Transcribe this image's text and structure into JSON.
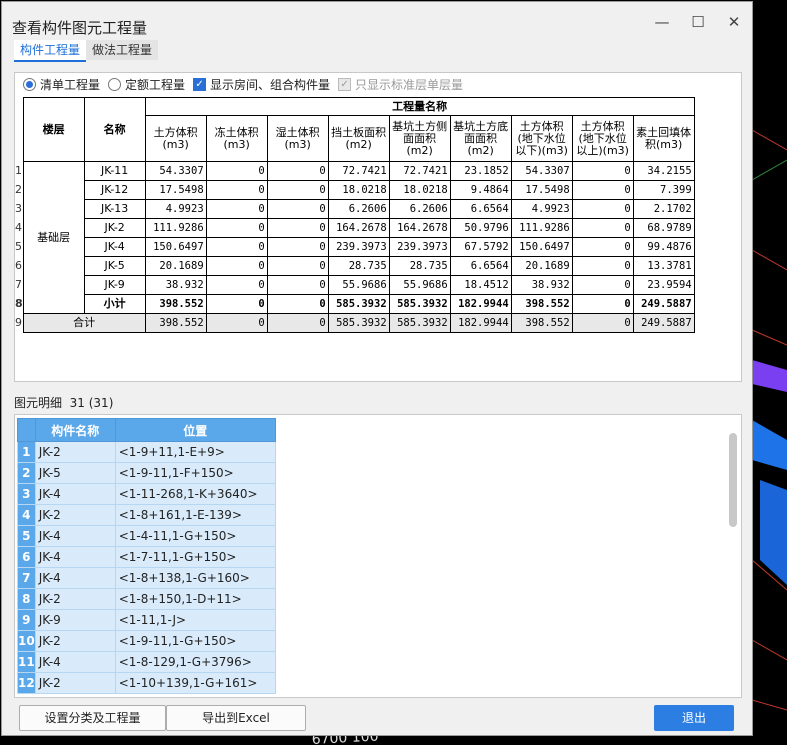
{
  "window": {
    "title": "查看构件图元工程量",
    "minimize": "—",
    "maximize": "☐",
    "close": "✕"
  },
  "tabs": [
    {
      "label": "构件工程量"
    },
    {
      "label": "做法工程量"
    }
  ],
  "options": {
    "radio_bill": "清单工程量",
    "radio_quota": "定额工程量",
    "check_rooms": "显示房间、组合构件量",
    "check_std": "只显示标准层单层量"
  },
  "table": {
    "group_header": "工程量名称",
    "col_floor": "楼层",
    "col_name": "名称",
    "columns": [
      "土方体积(m3)",
      "冻土体积(m3)",
      "湿土体积(m3)",
      "挡土板面积(m2)",
      "基坑土方侧面面积(m2)",
      "基坑土方底面面积(m2)",
      "土方体积(地下水位以下)(m3)",
      "土方体积(地下水位以上)(m3)",
      "素土回填体积(m3)"
    ],
    "floor": "基础层",
    "row_numbers": [
      "1",
      "2",
      "3",
      "4",
      "5",
      "6",
      "7",
      "8",
      "9"
    ],
    "rows": [
      {
        "name": "JK-11",
        "values": [
          "54.3307",
          "0",
          "0",
          "72.7421",
          "72.7421",
          "23.1852",
          "54.3307",
          "0",
          "34.2155"
        ]
      },
      {
        "name": "JK-12",
        "values": [
          "17.5498",
          "0",
          "0",
          "18.0218",
          "18.0218",
          "9.4864",
          "17.5498",
          "0",
          "7.399"
        ]
      },
      {
        "name": "JK-13",
        "values": [
          "4.9923",
          "0",
          "0",
          "6.2606",
          "6.2606",
          "6.6564",
          "4.9923",
          "0",
          "2.1702"
        ]
      },
      {
        "name": "JK-2",
        "values": [
          "111.9286",
          "0",
          "0",
          "164.2678",
          "164.2678",
          "50.9796",
          "111.9286",
          "0",
          "68.9789"
        ]
      },
      {
        "name": "JK-4",
        "values": [
          "150.6497",
          "0",
          "0",
          "239.3973",
          "239.3973",
          "67.5792",
          "150.6497",
          "0",
          "99.4876"
        ]
      },
      {
        "name": "JK-5",
        "values": [
          "20.1689",
          "0",
          "0",
          "28.735",
          "28.735",
          "6.6564",
          "20.1689",
          "0",
          "13.3781"
        ]
      },
      {
        "name": "JK-9",
        "values": [
          "38.932",
          "0",
          "0",
          "55.9686",
          "55.9686",
          "18.4512",
          "38.932",
          "0",
          "23.9594"
        ]
      }
    ],
    "subtotal": {
      "name": "小计",
      "values": [
        "398.552",
        "0",
        "0",
        "585.3932",
        "585.3932",
        "182.9944",
        "398.552",
        "0",
        "249.5887"
      ]
    },
    "total": {
      "name": "合计",
      "values": [
        "398.552",
        "0",
        "0",
        "585.3932",
        "585.3932",
        "182.9944",
        "398.552",
        "0",
        "249.5887"
      ]
    }
  },
  "detail": {
    "label": "图元明细",
    "count": "31 (31)",
    "col_name": "构件名称",
    "col_pos": "位置",
    "rows": [
      {
        "idx": "1",
        "name": "JK-2",
        "pos": "<1-9+11,1-E+9>"
      },
      {
        "idx": "2",
        "name": "JK-5",
        "pos": "<1-9-11,1-F+150>"
      },
      {
        "idx": "3",
        "name": "JK-4",
        "pos": "<1-11-268,1-K+3640>"
      },
      {
        "idx": "4",
        "name": "JK-2",
        "pos": "<1-8+161,1-E-139>"
      },
      {
        "idx": "5",
        "name": "JK-4",
        "pos": "<1-4-11,1-G+150>"
      },
      {
        "idx": "6",
        "name": "JK-4",
        "pos": "<1-7-11,1-G+150>"
      },
      {
        "idx": "7",
        "name": "JK-4",
        "pos": "<1-8+138,1-G+160>"
      },
      {
        "idx": "8",
        "name": "JK-2",
        "pos": "<1-8+150,1-D+11>"
      },
      {
        "idx": "9",
        "name": "JK-9",
        "pos": "<1-11,1-J>"
      },
      {
        "idx": "10",
        "name": "JK-2",
        "pos": "<1-9-11,1-G+150>"
      },
      {
        "idx": "11",
        "name": "JK-4",
        "pos": "<1-8-129,1-G+3796>"
      },
      {
        "idx": "12",
        "name": "JK-2",
        "pos": "<1-10+139,1-G+161>"
      }
    ]
  },
  "buttons": {
    "settings": "设置分类及工程量",
    "export": "导出到Excel",
    "exit": "退出"
  },
  "background": {
    "dimension_text": "6700 100"
  },
  "colors": {
    "accent": "#2d7ee3",
    "header_blue": "#5aa7ea",
    "row_blue": "#d9ebfb",
    "bg_purple": "#7b3ff2"
  }
}
